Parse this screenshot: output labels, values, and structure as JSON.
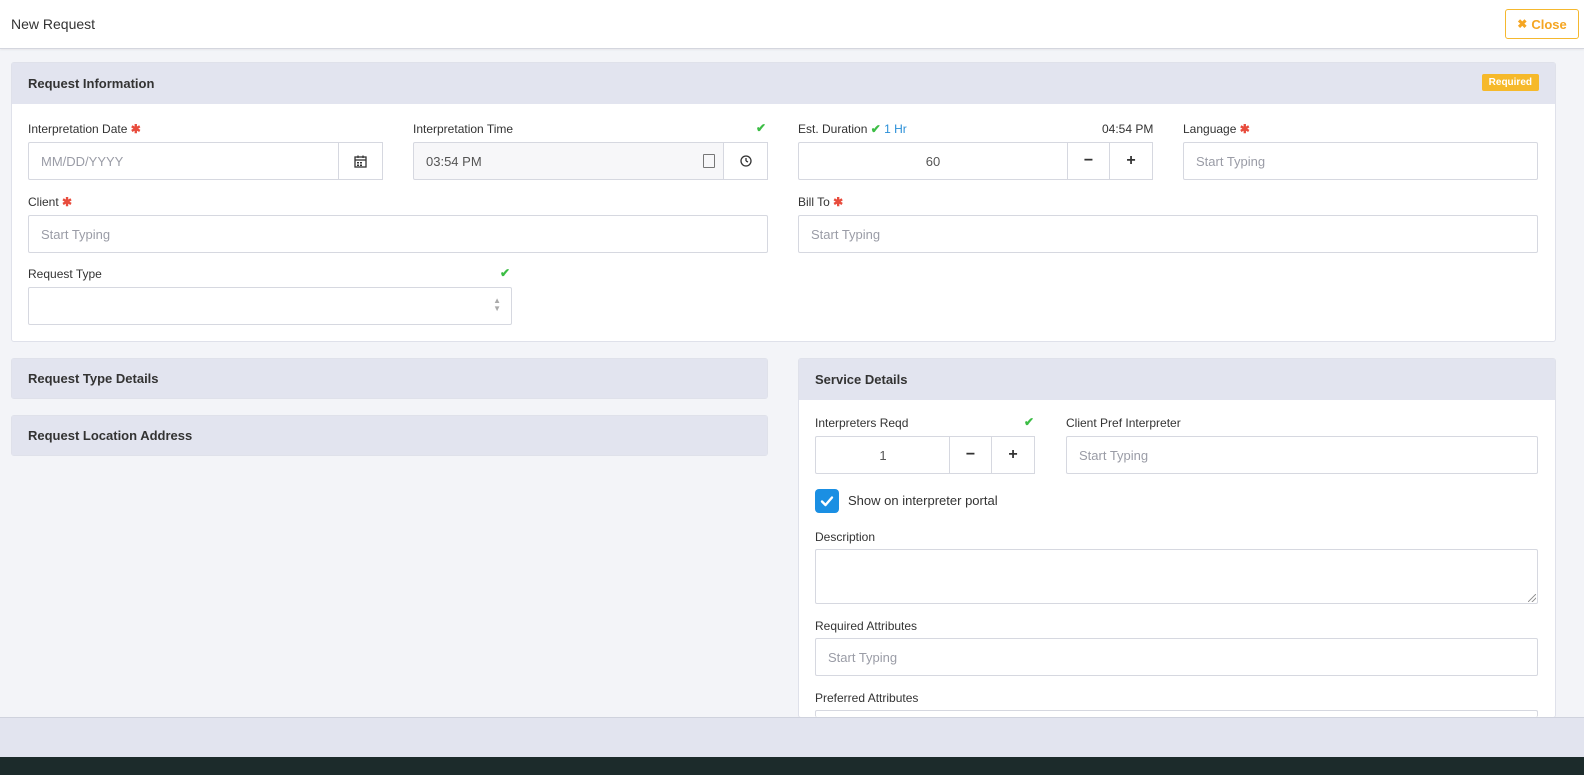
{
  "header": {
    "title": "New Request",
    "close_label": "Close"
  },
  "request_info": {
    "title": "Request Information",
    "required_badge": "Required",
    "interpretation_date": {
      "label": "Interpretation Date",
      "placeholder": "MM/DD/YYYY"
    },
    "interpretation_time": {
      "label": "Interpretation Time",
      "value": "03:54 PM"
    },
    "est_duration": {
      "label": "Est. Duration",
      "hint": "1 Hr",
      "end_time": "04:54 PM",
      "value": "60"
    },
    "language": {
      "label": "Language",
      "placeholder": "Start Typing"
    },
    "client": {
      "label": "Client",
      "placeholder": "Start Typing"
    },
    "bill_to": {
      "label": "Bill To",
      "placeholder": "Start Typing"
    },
    "request_type": {
      "label": "Request Type",
      "value": ""
    }
  },
  "request_type_details": {
    "title": "Request Type Details"
  },
  "request_location": {
    "title": "Request Location Address"
  },
  "service_details": {
    "title": "Service Details",
    "interpreters_reqd": {
      "label": "Interpreters Reqd",
      "value": "1"
    },
    "client_pref": {
      "label": "Client Pref Interpreter",
      "placeholder": "Start Typing"
    },
    "show_on_portal": {
      "label": "Show on interpreter portal",
      "checked": true
    },
    "description": {
      "label": "Description",
      "value": ""
    },
    "required_attributes": {
      "label": "Required Attributes",
      "placeholder": "Start Typing"
    },
    "preferred_attributes": {
      "label": "Preferred Attributes"
    }
  },
  "colors": {
    "accent_blue": "#1a8fe3",
    "warning": "#f6b92a",
    "success": "#3cbd45",
    "required": "#e84c3d"
  },
  "icons": [
    "close-icon",
    "calendar-icon",
    "clock-icon",
    "time-picker-icon",
    "check-icon",
    "asterisk-icon",
    "sort-arrows-icon",
    "minus-icon",
    "plus-icon"
  ]
}
